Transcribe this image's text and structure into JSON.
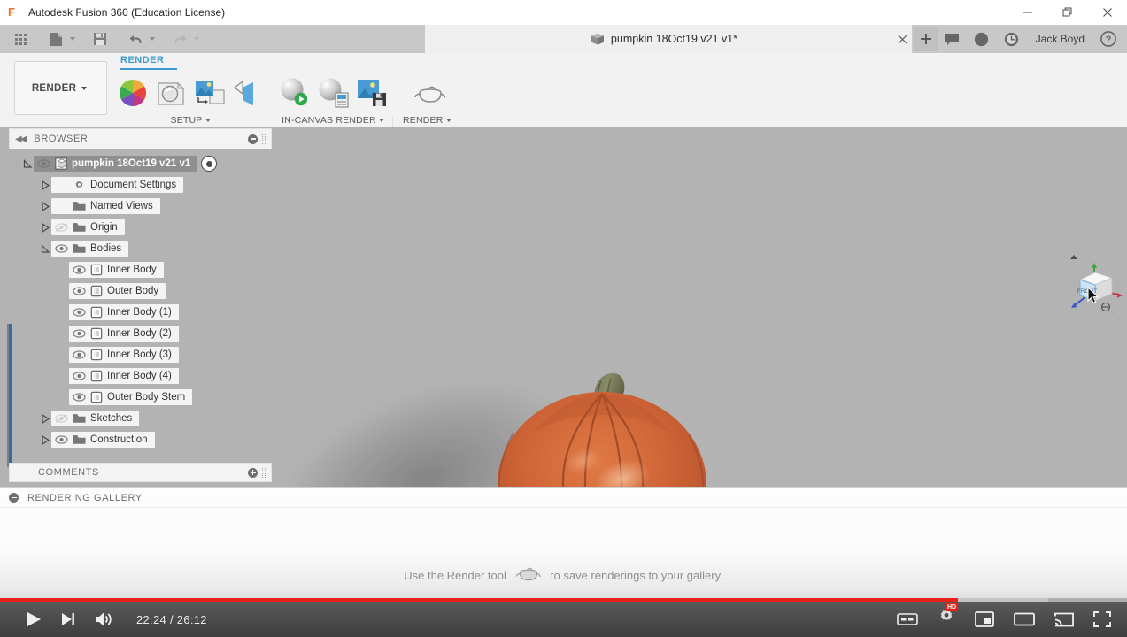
{
  "window": {
    "app_title": "Autodesk Fusion 360 (Education License)",
    "logo_letter": "F",
    "controls": [
      "minimize",
      "restore",
      "close"
    ]
  },
  "quick_access": {
    "items": [
      {
        "name": "app-grid-icon",
        "label": "Show Data Panel"
      },
      {
        "name": "new-document-icon",
        "label": "File"
      },
      {
        "name": "save-icon",
        "label": "Save"
      },
      {
        "name": "undo-icon",
        "label": "Undo"
      },
      {
        "name": "redo-icon",
        "label": "Redo"
      }
    ],
    "document_tab": "pumpkin 18Oct19 v21 v1*",
    "close_label": "×",
    "new_tab_label": "+",
    "right_icons": [
      "comments-icon",
      "job-status-icon",
      "recent-icon",
      "help-icon"
    ],
    "user_name": "Jack Boyd"
  },
  "ribbon": {
    "workspace_button": "RENDER",
    "active_tab": "RENDER",
    "groups": [
      {
        "name": "setup",
        "label": "SETUP",
        "tools": [
          "appearance-icon",
          "scene-settings-icon",
          "decal-icon",
          "texture-map-controls-icon"
        ]
      },
      {
        "name": "in-canvas-render",
        "label": "IN-CANVAS RENDER",
        "tools": [
          "in-canvas-render-icon",
          "in-canvas-render-settings-icon",
          "capture-image-icon"
        ]
      },
      {
        "name": "render",
        "label": "RENDER",
        "tools": [
          "render-teapot-icon"
        ]
      }
    ]
  },
  "browser": {
    "header": "BROWSER",
    "collapse_icon": "double-chevron-left-icon",
    "minus_icon": "circle-minus-icon",
    "tree": [
      {
        "label": "pumpkin 18Oct19 v21 v1",
        "level": 0,
        "twisty": "expanded",
        "eye": "visible",
        "icon": "component-icon",
        "selected": true,
        "trailing": "activate-radio"
      },
      {
        "label": "Document Settings",
        "level": 1,
        "twisty": "collapsed",
        "eye": "none",
        "icon": "gear-icon",
        "selected": false
      },
      {
        "label": "Named Views",
        "level": 1,
        "twisty": "collapsed",
        "eye": "none",
        "icon": "folder-icon",
        "selected": false
      },
      {
        "label": "Origin",
        "level": 1,
        "twisty": "collapsed",
        "eye": "hidden",
        "icon": "folder-icon",
        "selected": false
      },
      {
        "label": "Bodies",
        "level": 1,
        "twisty": "expanded",
        "eye": "visible",
        "icon": "folder-icon",
        "selected": false
      },
      {
        "label": "Inner Body",
        "level": 2,
        "twisty": "none",
        "eye": "visible",
        "icon": "body-icon",
        "selected": false
      },
      {
        "label": "Outer Body",
        "level": 2,
        "twisty": "none",
        "eye": "visible",
        "icon": "body-icon",
        "selected": false
      },
      {
        "label": "Inner Body (1)",
        "level": 2,
        "twisty": "none",
        "eye": "visible",
        "icon": "body-icon",
        "selected": false
      },
      {
        "label": "Inner Body (2)",
        "level": 2,
        "twisty": "none",
        "eye": "visible",
        "icon": "body-icon",
        "selected": false
      },
      {
        "label": "Inner Body (3)",
        "level": 2,
        "twisty": "none",
        "eye": "visible",
        "icon": "body-icon",
        "selected": false
      },
      {
        "label": "Inner Body (4)",
        "level": 2,
        "twisty": "none",
        "eye": "visible",
        "icon": "body-icon",
        "selected": false
      },
      {
        "label": "Outer Body Stem",
        "level": 2,
        "twisty": "none",
        "eye": "visible",
        "icon": "body-icon",
        "selected": false
      },
      {
        "label": "Sketches",
        "level": 1,
        "twisty": "collapsed",
        "eye": "hidden",
        "icon": "folder-icon",
        "selected": false
      },
      {
        "label": "Construction",
        "level": 1,
        "twisty": "collapsed",
        "eye": "visible",
        "icon": "folder-icon",
        "selected": false
      }
    ]
  },
  "comments": {
    "header": "COMMENTS",
    "add_icon": "circle-plus-icon"
  },
  "viewport": {
    "model_name": "pumpkin",
    "background_color": "#b3b3b3",
    "pumpkin_body_color": "#c8613a",
    "pumpkin_stem_color": "#6d6f50",
    "nav_tools": [
      {
        "name": "orbit-icon",
        "has_caret": true
      },
      {
        "name": "look-at-icon",
        "has_caret": false
      },
      {
        "name": "pan-icon",
        "has_caret": false
      },
      {
        "name": "zoom-icon",
        "has_caret": false
      },
      {
        "name": "zoom-window-icon",
        "has_caret": true
      },
      {
        "name": "display-settings-icon",
        "has_caret": true
      },
      {
        "name": "grid-snaps-icon",
        "has_caret": true
      }
    ],
    "view_cube_face": "FRONT",
    "home_icon": "home-icon"
  },
  "gallery": {
    "header": "RENDERING GALLERY",
    "collapse_icon": "circle-minus-icon",
    "empty_message_before": "Use the Render tool",
    "empty_message_icon": "render-teapot-icon",
    "empty_message_after": "to save renderings to your gallery."
  },
  "player": {
    "play_label": "play",
    "next_label": "next",
    "volume_label": "volume",
    "time_display": "22:24 / 26:12",
    "current_time": "22:24",
    "duration": "26:12",
    "progress_percent": 85,
    "buffered_percent": 93,
    "progress_color": "#e62117",
    "right_controls": [
      {
        "name": "captions-icon",
        "label": "CC"
      },
      {
        "name": "settings-gear-icon",
        "label": "HD"
      },
      {
        "name": "miniplayer-icon",
        "label": ""
      },
      {
        "name": "theater-mode-icon",
        "label": ""
      },
      {
        "name": "cast-icon",
        "label": ""
      },
      {
        "name": "fullscreen-icon",
        "label": ""
      }
    ]
  }
}
